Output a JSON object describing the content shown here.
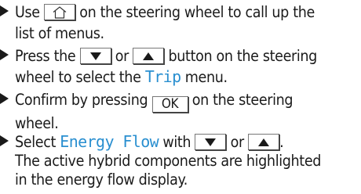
{
  "steps": [
    {
      "line1_a": "Use",
      "line1_b": "on the steering wheel to call up the",
      "line2": "list of menus."
    },
    {
      "line1_a": "Press the",
      "line1_b": "or",
      "line1_c": "button on the steering",
      "line2_a": "wheel to select the",
      "line2_menu": "Trip",
      "line2_b": "menu."
    },
    {
      "line1_a": "Confirm by pressing",
      "ok_label": "OK",
      "line1_b": "on the steering",
      "line2": "wheel."
    },
    {
      "line1_a": "Select",
      "line1_menu": "Energy Flow",
      "line1_b": "with",
      "line1_c": "or",
      "line1_d": ".",
      "line2": "The active hybrid components are highlighted",
      "line3": "in the energy flow display."
    }
  ],
  "icons": {
    "home": "home-icon",
    "down": "down-triangle-icon",
    "up": "up-triangle-icon"
  },
  "colors": {
    "menu_text": "#2a8fd0",
    "text": "#1a1a1a"
  }
}
